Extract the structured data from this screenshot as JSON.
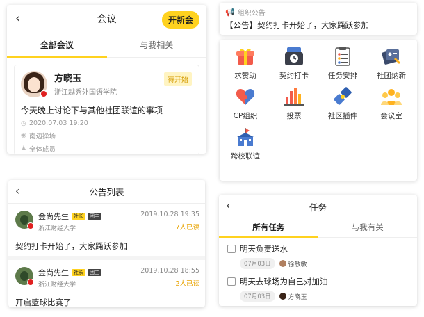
{
  "meeting": {
    "title": "会议",
    "new_button": "开新会",
    "tabs": [
      "全部会议",
      "与我相关"
    ],
    "item": {
      "host_name": "方晓玉",
      "school": "浙江越秀外国语学院",
      "status": "待开始",
      "topic": "今天晚上讨论下与其他社团联谊的事项",
      "datetime": "2020.07.03 19:20",
      "location": "南边操场",
      "participants": "全体成员"
    }
  },
  "notice": {
    "label": "组织公告",
    "text": "【公告】契约打卡开始了，大家踊跃参加"
  },
  "grid": {
    "items": [
      {
        "label": "求赞助",
        "icon": "gift-icon"
      },
      {
        "label": "契约打卡",
        "icon": "checkin-icon"
      },
      {
        "label": "任务安排",
        "icon": "checklist-icon"
      },
      {
        "label": "社团纳新",
        "icon": "recruit-icon"
      },
      {
        "label": "CP组织",
        "icon": "heart-puzzle-icon"
      },
      {
        "label": "投票",
        "icon": "vote-bars-icon"
      },
      {
        "label": "社区插件",
        "icon": "plugin-icon"
      },
      {
        "label": "会议室",
        "icon": "meeting-room-icon"
      },
      {
        "label": "跨校联谊",
        "icon": "school-icon"
      }
    ]
  },
  "announcements": {
    "title": "公告列表",
    "posts": [
      {
        "author": "金尚先生",
        "tag1": "社长",
        "tag2": "团主",
        "school": "浙江财经大学",
        "time": "2019.10.28 19:35",
        "read": "7人已读",
        "body": "契约打卡开始了，大家踊跃参加"
      },
      {
        "author": "金尚先生",
        "tag1": "社长",
        "tag2": "团主",
        "school": "浙江财经大学",
        "time": "2019.10.28 18:55",
        "read": "2人已读",
        "body": "开启篮球比赛了"
      }
    ]
  },
  "tasks": {
    "title": "任务",
    "tabs": [
      "所有任务",
      "与我有关"
    ],
    "items": [
      {
        "title": "明天负责送水",
        "date": "07月03日",
        "assignee": "徐敏敏"
      },
      {
        "title": "明天去球场为自己对加油",
        "date": "07月03日",
        "assignee": "方晓玉"
      }
    ]
  },
  "colors": {
    "accent": "#ffd21f",
    "read_count": "#e8a300"
  }
}
